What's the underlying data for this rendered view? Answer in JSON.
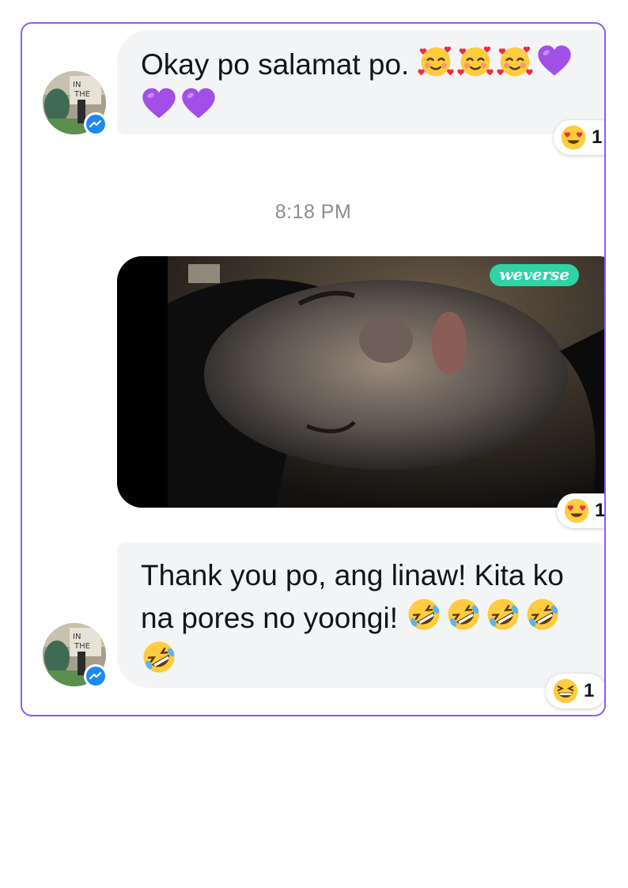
{
  "messages": [
    {
      "text": "Okay po salamat po.",
      "emojis": [
        "smiling-face-with-hearts",
        "smiling-face-with-hearts",
        "smiling-face-with-hearts",
        "purple-heart",
        "purple-heart",
        "purple-heart"
      ],
      "reaction": {
        "emoji": "heart-eyes",
        "count": "1"
      }
    },
    {
      "type": "video",
      "watermark": "weverse",
      "reaction": {
        "emoji": "heart-eyes",
        "count": "1"
      }
    },
    {
      "text_line1": "Thank you po, ang linaw! Kita ko",
      "text_line2": "na pores no yoongi!",
      "emojis": [
        "rolling-on-floor-laughing",
        "rolling-on-floor-laughing",
        "rolling-on-floor-laughing",
        "rolling-on-floor-laughing",
        "rolling-on-floor-laughing"
      ],
      "reaction": {
        "emoji": "grinning-squinting-face",
        "count": "1"
      }
    }
  ],
  "timestamp": "8:18 PM",
  "colors": {
    "frame_border": "#8a5cf6",
    "bubble_bg": "#f3f4f6",
    "messenger_blue": "#1e88f5",
    "weverse_green": "#2ed3a6"
  }
}
